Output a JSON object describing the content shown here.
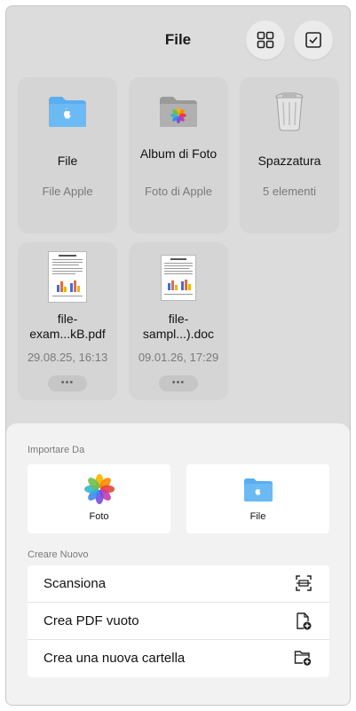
{
  "header": {
    "title": "File",
    "grid_icon": "grid-view-icon",
    "select_icon": "select-checkbox-icon"
  },
  "locations": [
    {
      "name": "File",
      "sub": "File Apple",
      "icon": "folder-icon"
    },
    {
      "name": "Album di Foto",
      "sub": "Foto di Apple",
      "icon": "photos-folder-icon"
    },
    {
      "name": "Spazzatura",
      "sub": "5 elementi",
      "icon": "trash-icon"
    }
  ],
  "documents": [
    {
      "name_line1": "file-",
      "name_line2": "exam...kB.pdf",
      "date": "29.08.25, 16:13",
      "more": "•••"
    },
    {
      "name_line1": "file-",
      "name_line2": "sampl...).doc",
      "date": "09.01.26, 17:29",
      "more": "•••"
    }
  ],
  "sheet": {
    "import_heading": "Importare Da",
    "import_options": [
      {
        "label": "Foto",
        "icon": "photos-icon"
      },
      {
        "label": "File",
        "icon": "folder-icon"
      }
    ],
    "create_heading": "Creare Nuovo",
    "create_options": [
      {
        "label": "Scansiona",
        "icon": "scan-icon"
      },
      {
        "label": "Crea PDF vuoto",
        "icon": "new-document-icon"
      },
      {
        "label": "Crea una nuova cartella",
        "icon": "new-folder-icon"
      }
    ]
  },
  "colors": {
    "folder_blue": "#5aaef0",
    "background": "#dcdcdc",
    "sheet": "#f2f2f2"
  }
}
